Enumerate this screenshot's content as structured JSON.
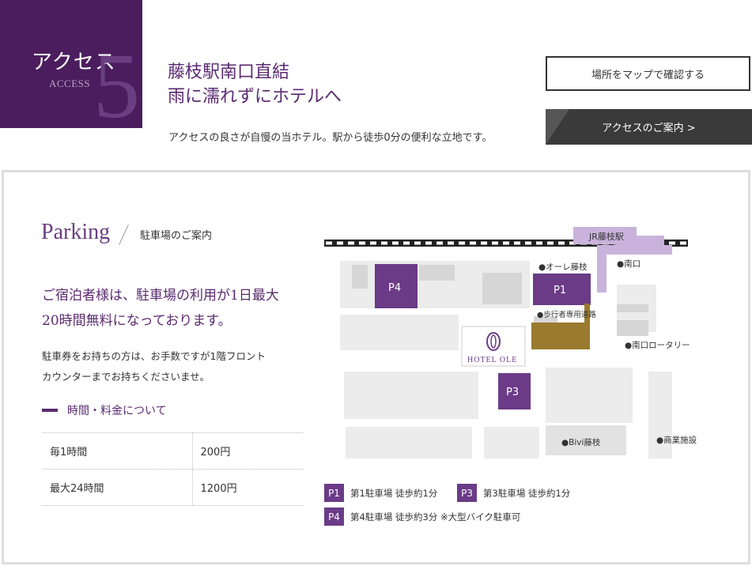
{
  "header": {
    "badge_jp": "アクセス",
    "badge_en": "ACCESS",
    "badge_num": "5",
    "title_line1": "藤枝駅南口直結",
    "title_line2": "雨に濡れずにホテルへ",
    "desc": "アクセスの良さが自慢の当ホテル。駅から徒歩0分の便利な立地です。",
    "map_button": "場所をマップで確認する",
    "access_button": "アクセスのご案内 >"
  },
  "parking": {
    "title": "Parking",
    "subtitle": "駐車場のご案内",
    "lead_line1": "ご宿泊者様は、駐車場の利用が1日最大",
    "lead_line2": "20時間無料になっております。",
    "note_line1": "駐車券をお持ちの方は、お手数ですが1階フロント",
    "note_line2": "カウンターまでお持ちくださいませ。",
    "section_title": "時間・料金について",
    "prices": [
      {
        "label": "毎1時間",
        "value": "200円"
      },
      {
        "label": "最大24時間",
        "value": "1200円"
      }
    ]
  },
  "map": {
    "station": "JR藤枝駅",
    "south_exit": "●南口",
    "ole": "●オーレ藤枝",
    "walkway": "●歩行者専用道路",
    "rotary": "●南口ロータリー",
    "bivi": "●Bivi藤枝",
    "commercial": "●商業施設",
    "hotel": "HOTEL OLE",
    "p1": "P1",
    "p3": "P3",
    "p4": "P4",
    "colors": {
      "parking": "#6b3b87",
      "station": "#c9b3dc",
      "hotel_lot": "#9a7a2e",
      "building": "#e2e2e2"
    }
  },
  "legend": [
    {
      "tag": "P1",
      "text": "第1駐車場  徒歩約1分"
    },
    {
      "tag": "P3",
      "text": "第3駐車場  徒歩約1分"
    },
    {
      "tag": "P4",
      "text": "第4駐車場  徒歩約3分  ※大型バイク駐車可"
    }
  ]
}
